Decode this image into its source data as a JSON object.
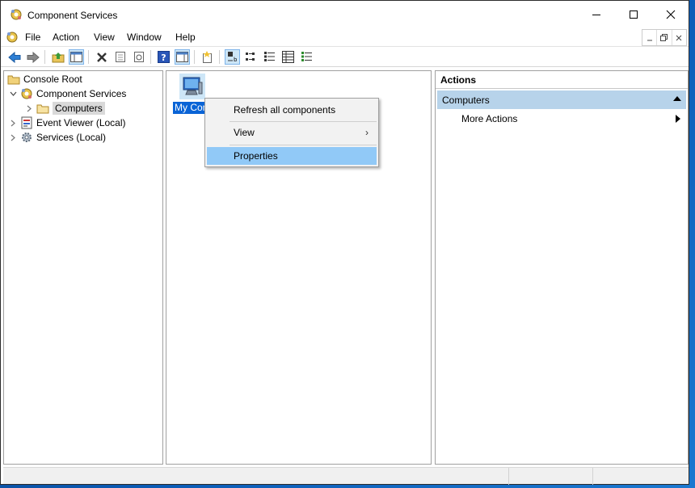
{
  "window": {
    "title": "Component Services"
  },
  "menubar": {
    "items": [
      "File",
      "Action",
      "View",
      "Window",
      "Help"
    ]
  },
  "toolbar": {
    "buttons": [
      "back-arrow-icon",
      "forward-arrow-icon",
      "up-folder-icon",
      "show-hide-console-tree-icon",
      "delete-icon",
      "properties-icon",
      "refresh-icon",
      "help-icon",
      "show-hide-action-pane-icon",
      "new-item-icon",
      "large-icons-view-icon",
      "small-icons-view-icon",
      "list-view-icon",
      "detail-view-icon"
    ]
  },
  "tree": {
    "items": [
      {
        "label": "Console Root"
      },
      {
        "label": "Component Services"
      },
      {
        "label": "Computers"
      },
      {
        "label": "Event Viewer (Local)"
      },
      {
        "label": "Services (Local)"
      }
    ]
  },
  "list": {
    "item_label": "My Computer"
  },
  "context_menu": {
    "items": [
      {
        "label": "Refresh all components"
      },
      {
        "label": "View"
      },
      {
        "label": "Properties"
      }
    ]
  },
  "actions": {
    "header": "Actions",
    "group": "Computers",
    "item": "More Actions"
  },
  "colors": {
    "selection": "#0a64d6",
    "menu_highlight": "#91c9f7",
    "action_group": "#b7d3ea"
  }
}
